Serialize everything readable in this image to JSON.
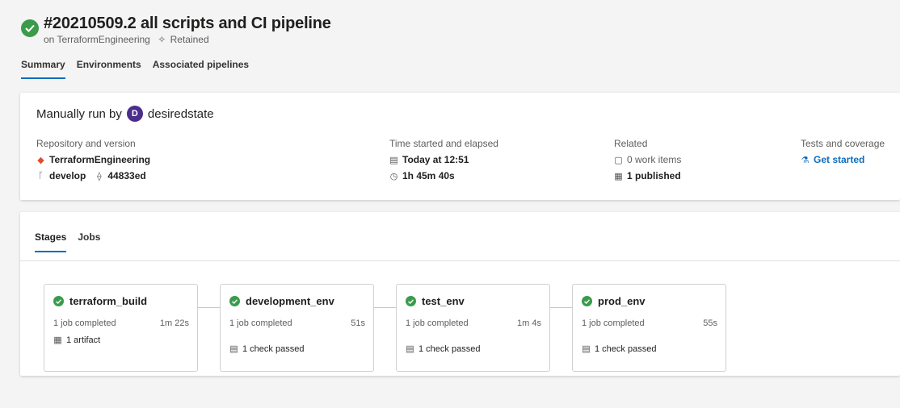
{
  "header": {
    "title": "#20210509.2 all scripts and CI pipeline",
    "subtitle_prefix": "on TerraformEngineering",
    "retained": "Retained",
    "status_color": "#3a9b4b"
  },
  "tabs": [
    "Summary",
    "Environments",
    "Associated pipelines"
  ],
  "summary": {
    "run_by": "Manually run by",
    "avatar_initial": "D",
    "user": "desiredstate",
    "repo": {
      "label": "Repository and version",
      "name": "TerraformEngineering",
      "branch": "develop",
      "commit": "44833ed"
    },
    "time": {
      "label": "Time started and elapsed",
      "started": "Today at 12:51",
      "elapsed": "1h 45m 40s"
    },
    "related": {
      "label": "Related",
      "work_items": "0 work items",
      "published": "1 published"
    },
    "tests": {
      "label": "Tests and coverage",
      "link": "Get started"
    }
  },
  "stage_tabs": [
    "Stages",
    "Jobs"
  ],
  "stages": [
    {
      "name": "terraform_build",
      "jobs": "1 job completed",
      "duration": "1m 22s",
      "extra": "1 artifact",
      "extra_icon": "artifact-icon"
    },
    {
      "name": "development_env",
      "jobs": "1 job completed",
      "duration": "51s",
      "extra": "1 check passed",
      "extra_icon": "check-doc-icon"
    },
    {
      "name": "test_env",
      "jobs": "1 job completed",
      "duration": "1m 4s",
      "extra": "1 check passed",
      "extra_icon": "check-doc-icon"
    },
    {
      "name": "prod_env",
      "jobs": "1 job completed",
      "duration": "55s",
      "extra": "1 check passed",
      "extra_icon": "check-doc-icon"
    }
  ],
  "colors": {
    "success": "#3a9b4b",
    "link": "#0f6cbd",
    "avatar": "#4b2d8c"
  }
}
